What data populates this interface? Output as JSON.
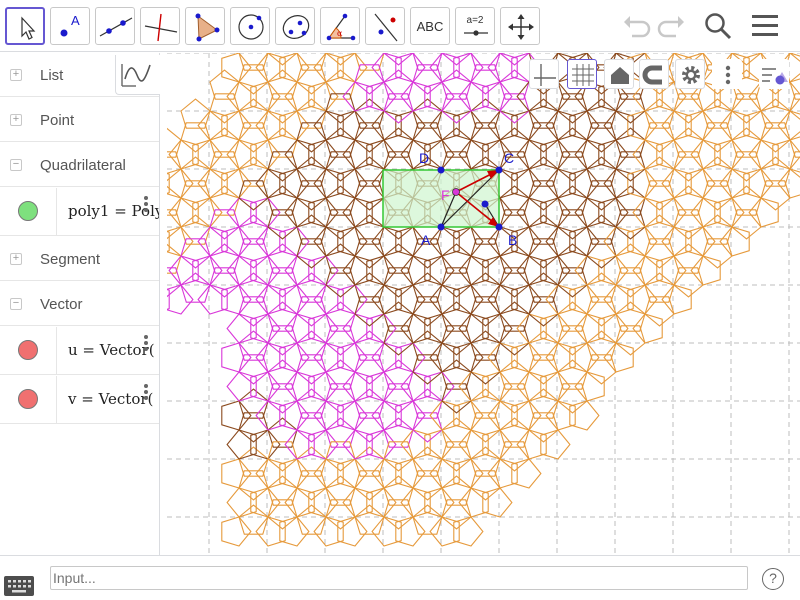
{
  "toolbar": {
    "tools": [
      {
        "name": "move-tool",
        "label": ""
      },
      {
        "name": "point-tool",
        "label": "A"
      },
      {
        "name": "line-tool",
        "label": ""
      },
      {
        "name": "perpendicular-line-tool",
        "label": ""
      },
      {
        "name": "polygon-tool",
        "label": ""
      },
      {
        "name": "circle-tool",
        "label": ""
      },
      {
        "name": "conic-tool",
        "label": ""
      },
      {
        "name": "angle-tool",
        "label": "α"
      },
      {
        "name": "reflect-tool",
        "label": ""
      },
      {
        "name": "text-tool",
        "label": "ABC"
      },
      {
        "name": "slider-tool",
        "label": "a=2"
      },
      {
        "name": "move-graphics-tool",
        "label": ""
      }
    ]
  },
  "algebra": {
    "categories": {
      "list": "List",
      "point": "Point",
      "quadrilateral": "Quadrilateral",
      "segment": "Segment",
      "vector": "Vector"
    },
    "objects": {
      "poly1": "poly1 = Poly",
      "u": "u = Vector(",
      "v": "v = Vector("
    }
  },
  "graphics": {
    "point_labels": {
      "A": "A",
      "B": "B",
      "C": "C",
      "D": "D",
      "F": "F"
    }
  },
  "input": {
    "placeholder": "Input..."
  },
  "help": {
    "label": "?"
  },
  "colors": {
    "accent": "#6557d2",
    "tile_orange": "#e69a3c",
    "tile_brown": "#8b4a1e",
    "tile_magenta": "#d937d9",
    "rect_fill": "#cff5cf",
    "rect_stroke": "#34c734",
    "point_blue": "#1a1acc",
    "vector_red": "#cc0000",
    "marble_green": "#7ee07e",
    "marble_red": "#f07070"
  }
}
